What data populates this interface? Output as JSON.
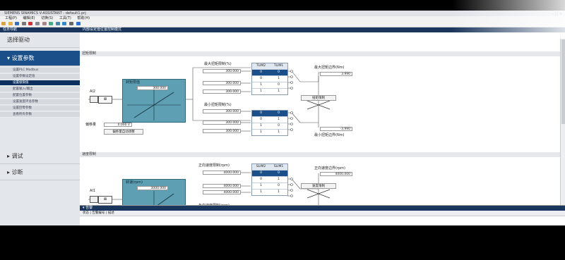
{
  "window": {
    "title": "SIEMENS SINAMICS V-ASSISTANT - default1.prj",
    "controls": "– □ ×"
  },
  "menu": [
    "工程(P)",
    "编辑(E)",
    "切换(S)",
    "工具(T)",
    "帮助(H)"
  ],
  "panes": {
    "left_title": "任务导航",
    "right_title": "内部设定值位置控制模式"
  },
  "sidebar": {
    "items": [
      {
        "label": "选择驱动"
      },
      {
        "label": "设置参数",
        "active": true
      },
      {
        "label": "调试"
      },
      {
        "label": "诊断"
      }
    ],
    "sub_items": [
      "设置PLC Modbus",
      "设置参数设定值",
      "设置极限值",
      "配置输入/输出",
      "配置位置参数",
      "设置速度环总参数",
      "设置回零参数",
      "查看所有参数"
    ],
    "selected_sub": 2
  },
  "torque_section": {
    "title": "扭矩限制",
    "ai_label": "AI2",
    "func_box_label": "转矩限值",
    "func_box_value": "300.000",
    "offset_label": "偏移量",
    "offset_value": "0.000 V",
    "offset_button": "偏移量自动调整",
    "max_label": "最大扭矩限制(%)",
    "max_fields": [
      "300.000",
      "300.000",
      "300.000"
    ],
    "min_label": "最小扭矩限制(%)",
    "min_fields": [
      "300.000",
      "300.000",
      "300.000"
    ],
    "table_headers": [
      "TLIM2",
      "TLIM1"
    ],
    "table_rows": [
      [
        "0",
        "0"
      ],
      [
        "0",
        "1"
      ],
      [
        "1",
        "0"
      ],
      [
        "1",
        "1"
      ]
    ],
    "table2_rows": [
      [
        "0",
        "0"
      ],
      [
        "0",
        "1"
      ],
      [
        "1",
        "0"
      ],
      [
        "1",
        "1"
      ]
    ],
    "out_max_label": "最大扭矩边界(Nm)",
    "out_max_value": "3.990",
    "out_min_label": "最小扭矩边界(Nm)",
    "out_min_value": "-3.990",
    "limiter_label": "扭矩限制"
  },
  "speed_section": {
    "title": "速度限制",
    "ai_label": "AI1",
    "func_box_label": "转速(rpm)",
    "func_box_value": "3000.000",
    "pos_label": "正向速度限制(rpm)",
    "pos_fields": [
      "4000.000",
      "4000.000",
      "4000.000"
    ],
    "neg_label": "负向速度限制(rpm)",
    "neg_fields": [
      "4000.000"
    ],
    "table_headers": [
      "SLIM2",
      "SLIM1"
    ],
    "table_rows": [
      [
        "0",
        "0"
      ],
      [
        "0",
        "1"
      ],
      [
        "1",
        "0"
      ],
      [
        "1",
        "1"
      ]
    ],
    "table2_rows": [
      [
        "0",
        "0"
      ]
    ],
    "out_pos_label": "正向速度边界(rpm)",
    "out_pos_value": "4000.000",
    "limiter_label": "速度限制"
  },
  "bottom_panel": {
    "title": "▾ 告警",
    "tabs": "状态 | 告警编号 | 描述"
  }
}
